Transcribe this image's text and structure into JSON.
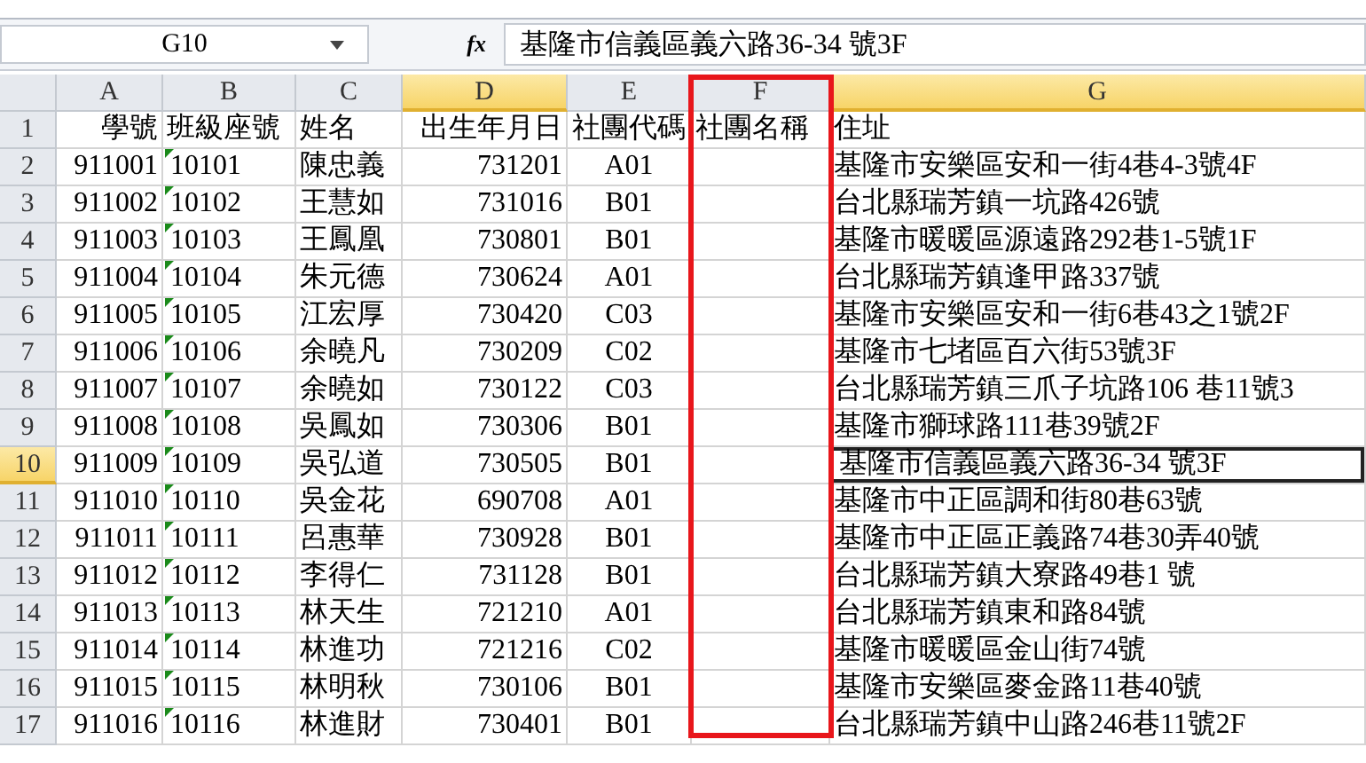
{
  "name_box": "G10",
  "formula_icon": "fx",
  "formula": "基隆市信義區義六路36-34 號3F",
  "columns": [
    {
      "label": "A",
      "selected": false,
      "active": false,
      "outlined": false
    },
    {
      "label": "B",
      "selected": false,
      "active": false,
      "outlined": false
    },
    {
      "label": "C",
      "selected": false,
      "active": false,
      "outlined": false
    },
    {
      "label": "D",
      "selected": true,
      "active": false,
      "outlined": false
    },
    {
      "label": "E",
      "selected": false,
      "active": false,
      "outlined": false
    },
    {
      "label": "F",
      "selected": false,
      "active": false,
      "outlined": true
    },
    {
      "label": "G",
      "selected": true,
      "active": true,
      "outlined": false
    }
  ],
  "rows": [
    {
      "number": "1",
      "selected": false,
      "error_marker": false,
      "cells": [
        "學號",
        "班級座號",
        "姓名",
        "出生年月日",
        "社團代碼",
        "社團名稱",
        "住址"
      ]
    },
    {
      "number": "2",
      "selected": false,
      "error_marker": true,
      "cells": [
        "911001",
        "10101",
        "陳忠義",
        "731201",
        "A01",
        "",
        "基隆市安樂區安和一街4巷4-3號4F"
      ]
    },
    {
      "number": "3",
      "selected": false,
      "error_marker": true,
      "cells": [
        "911002",
        "10102",
        "王慧如",
        "731016",
        "B01",
        "",
        "台北縣瑞芳鎮一坑路426號"
      ]
    },
    {
      "number": "4",
      "selected": false,
      "error_marker": true,
      "cells": [
        "911003",
        "10103",
        "王鳳凰",
        "730801",
        "B01",
        "",
        "基隆市暖暖區源遠路292巷1-5號1F"
      ]
    },
    {
      "number": "5",
      "selected": false,
      "error_marker": true,
      "cells": [
        "911004",
        "10104",
        "朱元德",
        "730624",
        "A01",
        "",
        "台北縣瑞芳鎮逢甲路337號"
      ]
    },
    {
      "number": "6",
      "selected": false,
      "error_marker": true,
      "cells": [
        "911005",
        "10105",
        "江宏厚",
        "730420",
        "C03",
        "",
        "基隆市安樂區安和一街6巷43之1號2F"
      ]
    },
    {
      "number": "7",
      "selected": false,
      "error_marker": true,
      "cells": [
        "911006",
        "10106",
        "余曉凡",
        "730209",
        "C02",
        "",
        "基隆市七堵區百六街53號3F"
      ]
    },
    {
      "number": "8",
      "selected": false,
      "error_marker": true,
      "cells": [
        "911007",
        "10107",
        "余曉如",
        "730122",
        "C03",
        "",
        "台北縣瑞芳鎮三爪子坑路106 巷11號3"
      ]
    },
    {
      "number": "9",
      "selected": false,
      "error_marker": true,
      "cells": [
        "911008",
        "10108",
        "吳鳳如",
        "730306",
        "B01",
        "",
        "基隆市獅球路111巷39號2F"
      ]
    },
    {
      "number": "10",
      "selected": true,
      "error_marker": true,
      "cells": [
        "911009",
        "10109",
        "吳弘道",
        "730505",
        "B01",
        "",
        "基隆市信義區義六路36-34 號3F"
      ]
    },
    {
      "number": "11",
      "selected": false,
      "error_marker": true,
      "cells": [
        "911010",
        "10110",
        "吳金花",
        "690708",
        "A01",
        "",
        "基隆市中正區調和街80巷63號"
      ]
    },
    {
      "number": "12",
      "selected": false,
      "error_marker": true,
      "cells": [
        "911011",
        "10111",
        "呂惠華",
        "730928",
        "B01",
        "",
        "基隆市中正區正義路74巷30弄40號"
      ]
    },
    {
      "number": "13",
      "selected": false,
      "error_marker": true,
      "cells": [
        "911012",
        "10112",
        "李得仁",
        "731128",
        "B01",
        "",
        "台北縣瑞芳鎮大寮路49巷1 號"
      ]
    },
    {
      "number": "14",
      "selected": false,
      "error_marker": true,
      "cells": [
        "911013",
        "10113",
        "林天生",
        "721210",
        "A01",
        "",
        "台北縣瑞芳鎮東和路84號"
      ]
    },
    {
      "number": "15",
      "selected": false,
      "error_marker": true,
      "cells": [
        "911014",
        "10114",
        "林進功",
        "721216",
        "C02",
        "",
        "基隆市暖暖區金山街74號"
      ]
    },
    {
      "number": "16",
      "selected": false,
      "error_marker": true,
      "cells": [
        "911015",
        "10115",
        "林明秋",
        "730106",
        "B01",
        "",
        "基隆市安樂區麥金路11巷40號"
      ]
    },
    {
      "number": "17",
      "selected": false,
      "error_marker": true,
      "cells": [
        "911016",
        "10116",
        "林進財",
        "730401",
        "B01",
        "",
        "台北縣瑞芳鎮中山路246巷11號2F"
      ]
    }
  ]
}
